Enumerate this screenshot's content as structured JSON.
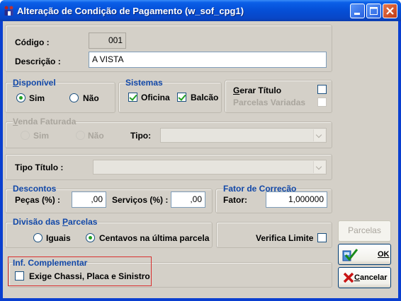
{
  "window": {
    "title": "Alteração de Condição de Pagamento (w_sof_cpg1)"
  },
  "fields": {
    "codigo_label": "Código :",
    "codigo_value": "001",
    "descricao_label": "Descrição :",
    "descricao_value": "A VISTA"
  },
  "disponivel": {
    "title": "Disponível",
    "sim": "Sim",
    "nao": "Não",
    "selected": "Sim"
  },
  "sistemas": {
    "title": "Sistemas",
    "oficina": "Oficina",
    "balcao": "Balcão",
    "oficina_checked": true,
    "balcao_checked": true
  },
  "gerar": {
    "gerar_titulo": "Gerar Título",
    "parcelas_variadas": "Parcelas Variadas"
  },
  "venda_faturada": {
    "title": "Venda Faturada",
    "sim": "Sim",
    "nao": "Não",
    "tipo_label": "Tipo:",
    "tipo_value": ""
  },
  "tipo_titulo": {
    "label": "Tipo Título :",
    "value": ""
  },
  "descontos": {
    "title": "Descontos",
    "pecas_label": "Peças (%) :",
    "pecas_value": ",00",
    "servicos_label": "Serviços (%) :",
    "servicos_value": ",00"
  },
  "fator": {
    "title": "Fator de Correção",
    "label": "Fator:",
    "value": "1,000000"
  },
  "divisao": {
    "title": "Divisão das Parcelas",
    "iguais": "Iguais",
    "centavos": "Centavos na última parcela",
    "selected": "Centavos na última parcela",
    "verifica_limite": "Verifica Limite"
  },
  "inf": {
    "title": "Inf. Complementar",
    "exige": "Exige Chassi, Placa e Sinistro"
  },
  "buttons": {
    "parcelas": "Parcelas",
    "ok": "OK",
    "cancelar": "Cancelar"
  },
  "colors": {
    "accent_blue": "#1248a8",
    "highlight_red": "#d93030",
    "check_green": "#21a121"
  }
}
